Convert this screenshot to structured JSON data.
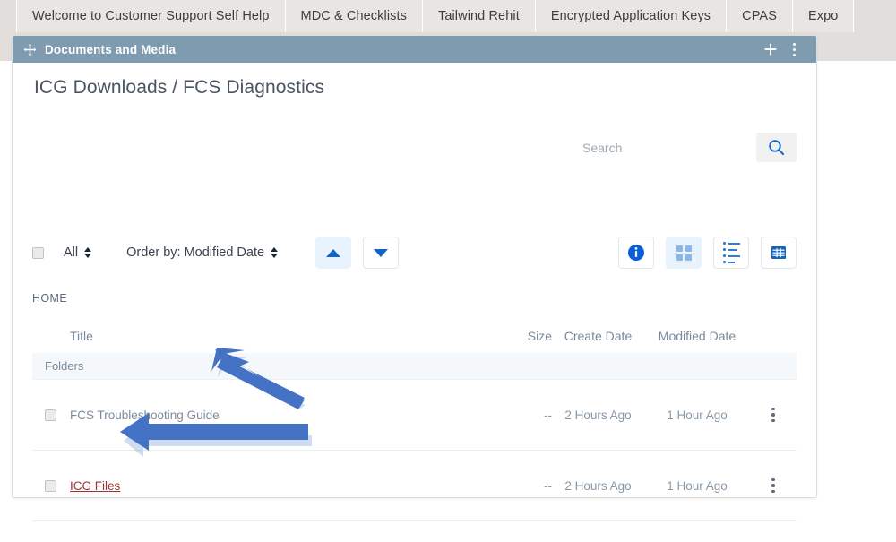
{
  "nav": {
    "tabs": [
      {
        "label": "Welcome to Customer Support Self Help"
      },
      {
        "label": "MDC & Checklists"
      },
      {
        "label": "Tailwind Rehit"
      },
      {
        "label": "Encrypted Application Keys"
      },
      {
        "label": "CPAS"
      },
      {
        "label": "Expo"
      }
    ]
  },
  "portlet": {
    "title": "Documents and Media",
    "header_color": "#7f9bb0",
    "add_label": "+",
    "menu_label": "options"
  },
  "document": {
    "title": "ICG Downloads / FCS Diagnostics"
  },
  "search": {
    "placeholder": "Search",
    "value": "",
    "button_label": "Search"
  },
  "toolbar": {
    "select_all_label": "All",
    "order_by_label": "Order by: Modified Date",
    "sort_ascending_label": "Sort Ascending",
    "sort_descending_label": "Sort Descending",
    "info_label": "Info",
    "view_card_label": "Card View",
    "view_list_label": "List View",
    "view_table_label": "Table View",
    "accent_color": "#1263c7",
    "active_tint": "#e8f3fd"
  },
  "breadcrumb": {
    "label": "HOME"
  },
  "table": {
    "columns": {
      "title": "Title",
      "size": "Size",
      "create_date": "Create Date",
      "modified_date": "Modified Date"
    },
    "sections": [
      {
        "label": "Folders",
        "rows": [
          {
            "title": "FCS Troubleshooting Guide",
            "is_link": false,
            "size": "--",
            "create_date": "2 Hours Ago",
            "modified_date": "1 Hour Ago"
          },
          {
            "title": "ICG Files",
            "is_link": true,
            "size": "--",
            "create_date": "2 Hours Ago",
            "modified_date": "1 Hour Ago"
          }
        ]
      }
    ]
  },
  "annotations": {
    "arrow_color": "#4472c4",
    "arrow_upper_target": "FCS Troubleshooting Guide",
    "arrow_lower_target": "ICG Files"
  }
}
